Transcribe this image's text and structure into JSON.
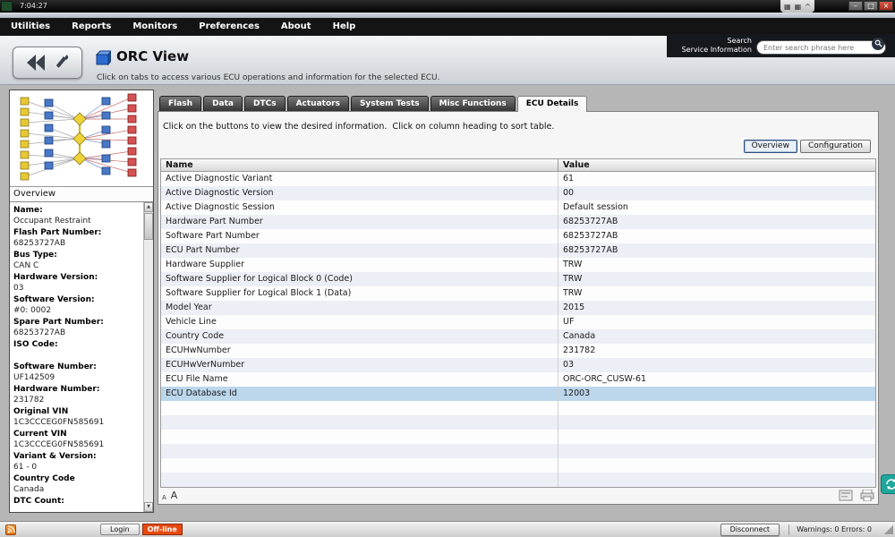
{
  "titlebar": {
    "time": "7:04:27"
  },
  "menubar": {
    "items": [
      "Utilities",
      "Reports",
      "Monitors",
      "Preferences",
      "About",
      "Help"
    ]
  },
  "search": {
    "label_line1": "Search",
    "label_line2": "Service Information",
    "placeholder": "Enter search phrase here"
  },
  "header": {
    "title": "ORC View",
    "subtitle": "Click on tabs to access various ECU operations and information for the selected ECU."
  },
  "sidebar": {
    "overview_label": "Overview",
    "fields": [
      {
        "label": "Name:",
        "value": "Occupant Restraint"
      },
      {
        "label": "Flash Part Number:",
        "value": "68253727AB"
      },
      {
        "label": "Bus Type:",
        "value": "CAN C"
      },
      {
        "label": "Hardware Version:",
        "value": "03"
      },
      {
        "label": "Software Version:",
        "value": "#0: 0002"
      },
      {
        "label": "Spare Part Number:",
        "value": "68253727AB"
      },
      {
        "label": "ISO Code:",
        "value": ""
      },
      {
        "label": "Software Number:",
        "value": "UF142509"
      },
      {
        "label": "Hardware Number:",
        "value": "231782"
      },
      {
        "label": "Original VIN",
        "value": "1C3CCCEG0FN585691"
      },
      {
        "label": "Current VIN",
        "value": "1C3CCCEG0FN585691"
      },
      {
        "label": "Variant & Version:",
        "value": "61 - 0"
      },
      {
        "label": "Country Code",
        "value": "Canada"
      },
      {
        "label": "DTC Count:",
        "value": ""
      }
    ]
  },
  "tabs": {
    "items": [
      {
        "label": "Flash"
      },
      {
        "label": "Data"
      },
      {
        "label": "DTCs"
      },
      {
        "label": "Actuators"
      },
      {
        "label": "System Tests"
      },
      {
        "label": "Misc Functions"
      },
      {
        "label": "ECU Details"
      }
    ]
  },
  "main": {
    "instruction": "Click on the buttons to view the desired information.  Click on column heading to sort table.",
    "view_buttons": [
      {
        "label": "Overview"
      },
      {
        "label": "Configuration"
      }
    ],
    "table": {
      "columns": [
        "Name",
        "Value"
      ],
      "rows": [
        [
          "Active Diagnostic Variant",
          "61"
        ],
        [
          "Active Diagnostic Version",
          "00"
        ],
        [
          "Active Diagnostic Session",
          "Default session"
        ],
        [
          "Hardware Part Number",
          "68253727AB"
        ],
        [
          "Software Part Number",
          "68253727AB"
        ],
        [
          "ECU Part Number",
          "68253727AB"
        ],
        [
          "Hardware Supplier",
          "TRW"
        ],
        [
          "Software Supplier for Logical Block 0 (Code)",
          "TRW"
        ],
        [
          "Software Supplier for Logical Block 1 (Data)",
          "TRW"
        ],
        [
          "Model Year",
          "2015"
        ],
        [
          "Vehicle Line",
          "UF"
        ],
        [
          "Country Code",
          "Canada"
        ],
        [
          "ECUHwNumber",
          "231782"
        ],
        [
          "ECUHwVerNumber",
          "03"
        ],
        [
          "ECU File Name",
          "ORC-ORC_CUSW-61"
        ],
        [
          "ECU Database Id",
          "12003"
        ]
      ],
      "selected_row_index": 15,
      "total_display_rows": 22
    }
  },
  "statusbar": {
    "login_label": "Login",
    "offline_label": "Off-line",
    "disconnect_label": "Disconnect",
    "warnings_text": "Warnings: 0 Errors: 0"
  },
  "icons": {
    "minimize": "–",
    "maximize": "□",
    "close": "×",
    "grid": "▦",
    "caret": "^",
    "scroll_up": "▲",
    "scroll_down": "▼",
    "font_small": "A",
    "font_large": "A"
  },
  "colors": {
    "accent_teal": "#1fa79b",
    "offline_red": "#e8490f",
    "selected_row": "#bcd6ec",
    "tab_dark": "#3a3a3a"
  }
}
